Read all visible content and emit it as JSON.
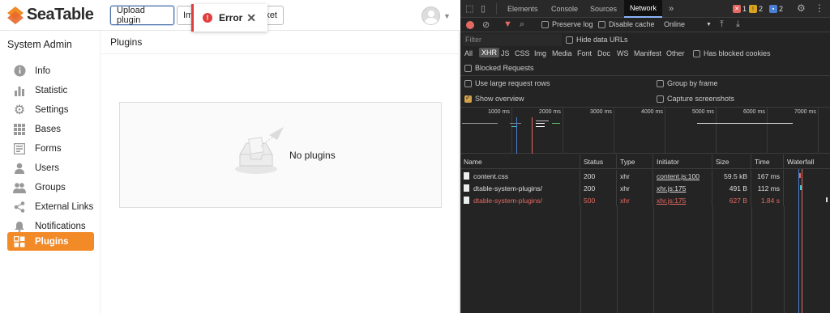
{
  "app": {
    "logo_text": "SeaTable",
    "header": {
      "upload_label": "Upload plugin",
      "import_label": "Imp",
      "market_label": "ket",
      "toast": {
        "label": "Error",
        "close_symbol": "✕"
      }
    },
    "sidebar": {
      "title": "System Admin",
      "items": [
        {
          "label": "Info",
          "icon": "info-icon"
        },
        {
          "label": "Statistic",
          "icon": "bar-chart-icon"
        },
        {
          "label": "Settings",
          "icon": "gear-icon"
        },
        {
          "label": "Bases",
          "icon": "grid-icon"
        },
        {
          "label": "Forms",
          "icon": "form-icon"
        },
        {
          "label": "Users",
          "icon": "user-icon"
        },
        {
          "label": "Groups",
          "icon": "group-icon"
        },
        {
          "label": "External Links",
          "icon": "share-icon"
        },
        {
          "label": "Notifications",
          "icon": "bell-icon"
        },
        {
          "label": "Plugins",
          "icon": "plugins-icon",
          "active": true
        }
      ]
    },
    "main": {
      "title": "Plugins",
      "empty_text": "No plugins"
    },
    "colors": {
      "accent": "#f28a28",
      "error": "#e03e3e"
    }
  },
  "devtools": {
    "tabs": [
      "Elements",
      "Console",
      "Sources",
      "Network"
    ],
    "active_tab": "Network",
    "more_symbol": "»",
    "errors": "1",
    "warnings": "2",
    "messages": "2",
    "toolbar": {
      "preserve_log": "Preserve log",
      "disable_cache": "Disable cache",
      "throttle": "Online"
    },
    "filter_placeholder": "Filter",
    "hide_data_urls": "Hide data URLs",
    "types": [
      "All",
      "XHR",
      "JS",
      "CSS",
      "Img",
      "Media",
      "Font",
      "Doc",
      "WS",
      "Manifest",
      "Other"
    ],
    "selected_type": "XHR",
    "has_blocked_cookies": "Has blocked cookies",
    "blocked_requests": "Blocked Requests",
    "options": {
      "large_rows": "Use large request rows",
      "group_by_frame": "Group by frame",
      "show_overview": "Show overview",
      "capture_screenshots": "Capture screenshots"
    },
    "timeline_ticks": [
      "1000 ms",
      "2000 ms",
      "3000 ms",
      "4000 ms",
      "5000 ms",
      "6000 ms",
      "7000 ms"
    ],
    "columns": [
      "Name",
      "Status",
      "Type",
      "Initiator",
      "Size",
      "Time",
      "Waterfall"
    ],
    "rows": [
      {
        "name": "content.css",
        "status": "200",
        "type": "xhr",
        "initiator": "content.js:100",
        "size": "59.5 kB",
        "time": "167 ms",
        "error": false
      },
      {
        "name": "dtable-system-plugins/",
        "status": "200",
        "type": "xhr",
        "initiator": "xhr.js:175",
        "size": "491 B",
        "time": "112 ms",
        "error": false
      },
      {
        "name": "dtable-system-plugins/",
        "status": "500",
        "type": "xhr",
        "initiator": "xhr.js:175",
        "size": "627 B",
        "time": "1.84 s",
        "error": true
      }
    ]
  }
}
